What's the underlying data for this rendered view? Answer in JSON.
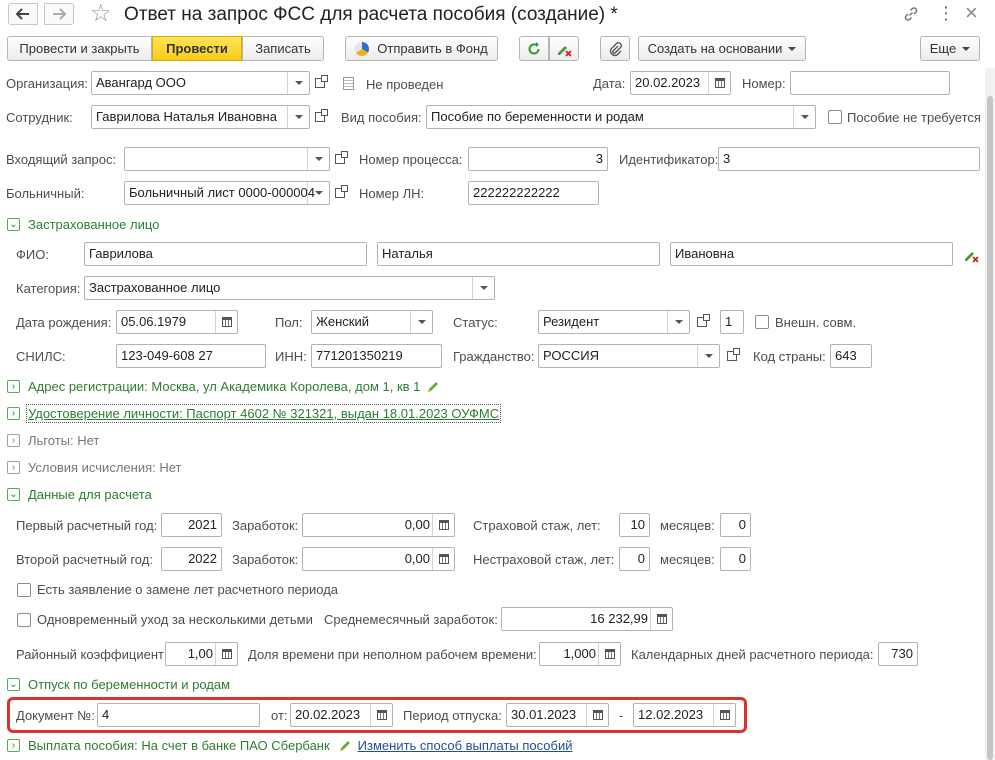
{
  "window": {
    "title": "Ответ на запрос ФСС для расчета пособия (создание) *",
    "star": "☆",
    "more": "⋮",
    "close": "×",
    "link_icon": "link-icon"
  },
  "toolbar": {
    "post_close": "Провести и закрыть",
    "post": "Провести",
    "write": "Записать",
    "send_fund": "Отправить в Фонд",
    "create_based": "Создать на основании",
    "more": "Еще"
  },
  "header": {
    "org_label": "Организация:",
    "org_value": "Авангард ООО",
    "not_posted": "Не проведен",
    "date_label": "Дата:",
    "date_value": "20.02.2023",
    "number_label": "Номер:",
    "number_value": "",
    "employee_label": "Сотрудник:",
    "employee_value": "Гаврилова Наталья Ивановна",
    "benefit_type_label": "Вид пособия:",
    "benefit_type_value": "Пособие по беременности и родам",
    "no_benefit_label": "Пособие не требуется",
    "incoming_label": "Входящий запрос:",
    "incoming_value": "",
    "process_num_label": "Номер процесса:",
    "process_num_value": "3",
    "ident_label": "Идентификатор:",
    "ident_value": "3",
    "sick_label": "Больничный:",
    "sick_value": "Больничный лист 0000-000004",
    "ln_label": "Номер ЛН:",
    "ln_value": "222222222222"
  },
  "insured": {
    "section": "Застрахованное лицо",
    "fio_label": "ФИО:",
    "last": "Гаврилова",
    "first": "Наталья",
    "middle": "Ивановна",
    "category_label": "Категория:",
    "category_value": "Застрахованное лицо",
    "birth_label": "Дата рождения:",
    "birth_value": "05.06.1979",
    "sex_label": "Пол:",
    "sex_value": "Женский",
    "status_label": "Статус:",
    "status_value": "Резидент",
    "status_code": "1",
    "ext_label": "Внешн. совм.",
    "snils_label": "СНИЛС:",
    "snils_value": "123-049-608 27",
    "inn_label": "ИНН:",
    "inn_value": "771201350219",
    "citizen_label": "Гражданство:",
    "citizen_value": "РОССИЯ",
    "country_label": "Код страны:",
    "country_value": "643"
  },
  "sections": {
    "address": "Адрес регистрации: Москва, ул Академика Королева, дом 1, кв 1",
    "identity": "Удостоверение личности: Паспорт 4602 № 321321, выдан 18.01.2023 ОУФМС",
    "benefits": "Льготы: Нет",
    "conditions": "Условия исчисления: Нет",
    "calc_data": "Данные для расчета",
    "maternity": "Отпуск по беременности и родам",
    "payment": "Выплата пособия: На счет в банке ПАО Сбербанк",
    "change_payment": "Изменить способ выплаты пособий"
  },
  "calc": {
    "year1_label": "Первый расчетный год:",
    "year1": "2021",
    "earn_label": "Заработок:",
    "earn1": "0,00",
    "ins_exp_label": "Страховой стаж, лет:",
    "ins_exp_years": "10",
    "months_label": "месяцев:",
    "ins_exp_months": "0",
    "year2_label": "Второй расчетный год:",
    "year2": "2022",
    "earn2": "0,00",
    "nonins_exp_label": "Нестраховой стаж, лет:",
    "nonins_years": "0",
    "nonins_months": "0",
    "replace_years_label": "Есть заявление о замене лет расчетного периода",
    "multi_child_label": "Одновременный уход за несколькими детьми",
    "avg_label": "Среднемесячный заработок:",
    "avg_value": "16 232,99",
    "district_label": "Районный коэффициент:",
    "district_value": "1,00",
    "parttime_label": "Доля времени при неполном рабочем времени:",
    "parttime_value": "1,000",
    "caldays_label": "Календарных дней расчетного периода:",
    "caldays_value": "730"
  },
  "maternity": {
    "doc_label": "Документ №:",
    "doc_value": "4",
    "from_label": "от:",
    "from_value": "20.02.2023",
    "period_label": "Период отпуска:",
    "period_start": "30.01.2023",
    "dash": "-",
    "period_end": "12.02.2023"
  },
  "colors": {
    "accent_green": "#2e7d32",
    "highlight_red": "#d9342b",
    "post_yellow": "#f7cd1a"
  }
}
